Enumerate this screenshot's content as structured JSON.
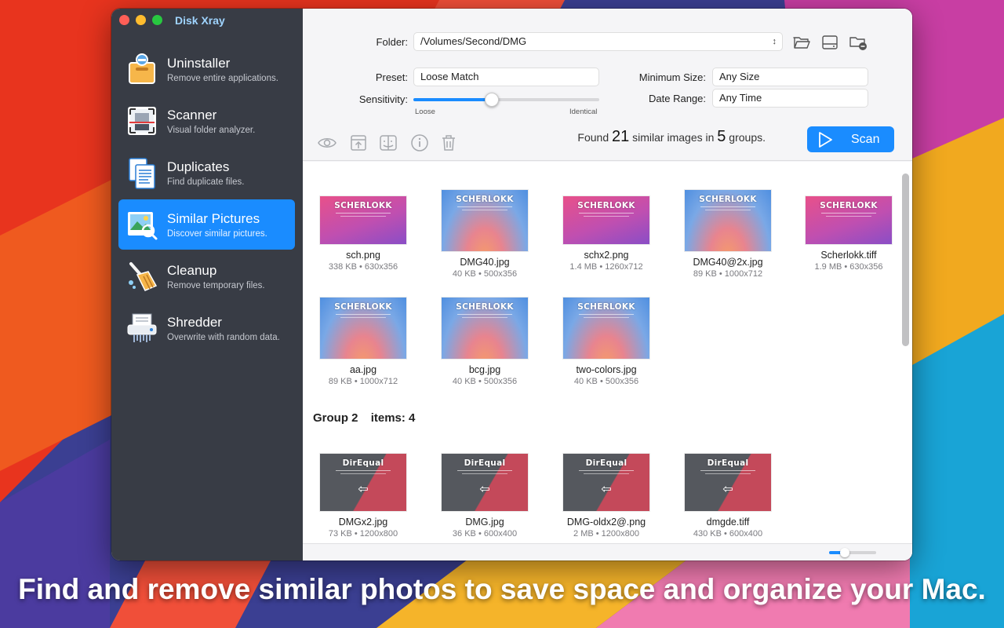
{
  "app": {
    "title": "Disk Xray"
  },
  "sidebar": {
    "items": [
      {
        "title": "Uninstaller",
        "subtitle": "Remove entire applications.",
        "icon": "uninstaller-box-icon",
        "active": false
      },
      {
        "title": "Scanner",
        "subtitle": "Visual folder analyzer.",
        "icon": "scanner-icon",
        "active": false
      },
      {
        "title": "Duplicates",
        "subtitle": "Find duplicate files.",
        "icon": "duplicates-documents-icon",
        "active": false
      },
      {
        "title": "Similar Pictures",
        "subtitle": "Discover similar pictures.",
        "icon": "similar-pictures-icon",
        "active": true
      },
      {
        "title": "Cleanup",
        "subtitle": "Remove temporary files.",
        "icon": "cleanup-broom-icon",
        "active": false
      },
      {
        "title": "Shredder",
        "subtitle": "Overwrite with random data.",
        "icon": "shredder-icon",
        "active": false
      }
    ]
  },
  "settings": {
    "folder_label": "Folder:",
    "folder_value": "/Volumes/Second/DMG",
    "preset_label": "Preset:",
    "preset_value": "Loose Match",
    "sensitivity_label": "Sensitivity:",
    "sensitivity_min": "Loose",
    "sensitivity_max": "Identical",
    "sensitivity_level": 0.42,
    "min_size_label": "Minimum Size:",
    "min_size_value": "Any Size",
    "date_range_label": "Date Range:",
    "date_range_value": "Any Time"
  },
  "summary": {
    "prefix": "Found",
    "images_count": "21",
    "middle": "similar images in",
    "groups_count": "5",
    "suffix": "groups."
  },
  "scan_button": {
    "label": "Scan"
  },
  "group1": {
    "items": [
      {
        "name": "sch.png",
        "meta": "338 KB • 630x356",
        "style": "pink"
      },
      {
        "name": "DMG40.jpg",
        "meta": "40 KB • 500x356",
        "style": "blue"
      },
      {
        "name": "schx2.png",
        "meta": "1.4 MB • 1260x712",
        "style": "pink"
      },
      {
        "name": "DMG40@2x.jpg",
        "meta": "89 KB • 1000x712",
        "style": "blue"
      },
      {
        "name": "Scherlokk.tiff",
        "meta": "1.9 MB • 630x356",
        "style": "pink"
      },
      {
        "name": "aa.jpg",
        "meta": "89 KB • 1000x712",
        "style": "blue"
      },
      {
        "name": "bcg.jpg",
        "meta": "40 KB • 500x356",
        "style": "blue"
      },
      {
        "name": "two-colors.jpg",
        "meta": "40 KB • 500x356",
        "style": "blue"
      }
    ],
    "brand": "SCHERLOKK"
  },
  "group2": {
    "label": "Group 2",
    "items_label": "items: 4",
    "brand": "DirEqual",
    "items": [
      {
        "name": "DMGx2.jpg",
        "meta": "73 KB • 1200x800"
      },
      {
        "name": "DMG.jpg",
        "meta": "36 KB • 600x400"
      },
      {
        "name": "DMG-oldx2@.png",
        "meta": "2 MB • 1200x800"
      },
      {
        "name": "dmgde.tiff",
        "meta": "430 KB • 600x400"
      }
    ]
  },
  "zoom_level": 0.33,
  "caption": "Find and remove similar photos to save space and organize your Mac."
}
